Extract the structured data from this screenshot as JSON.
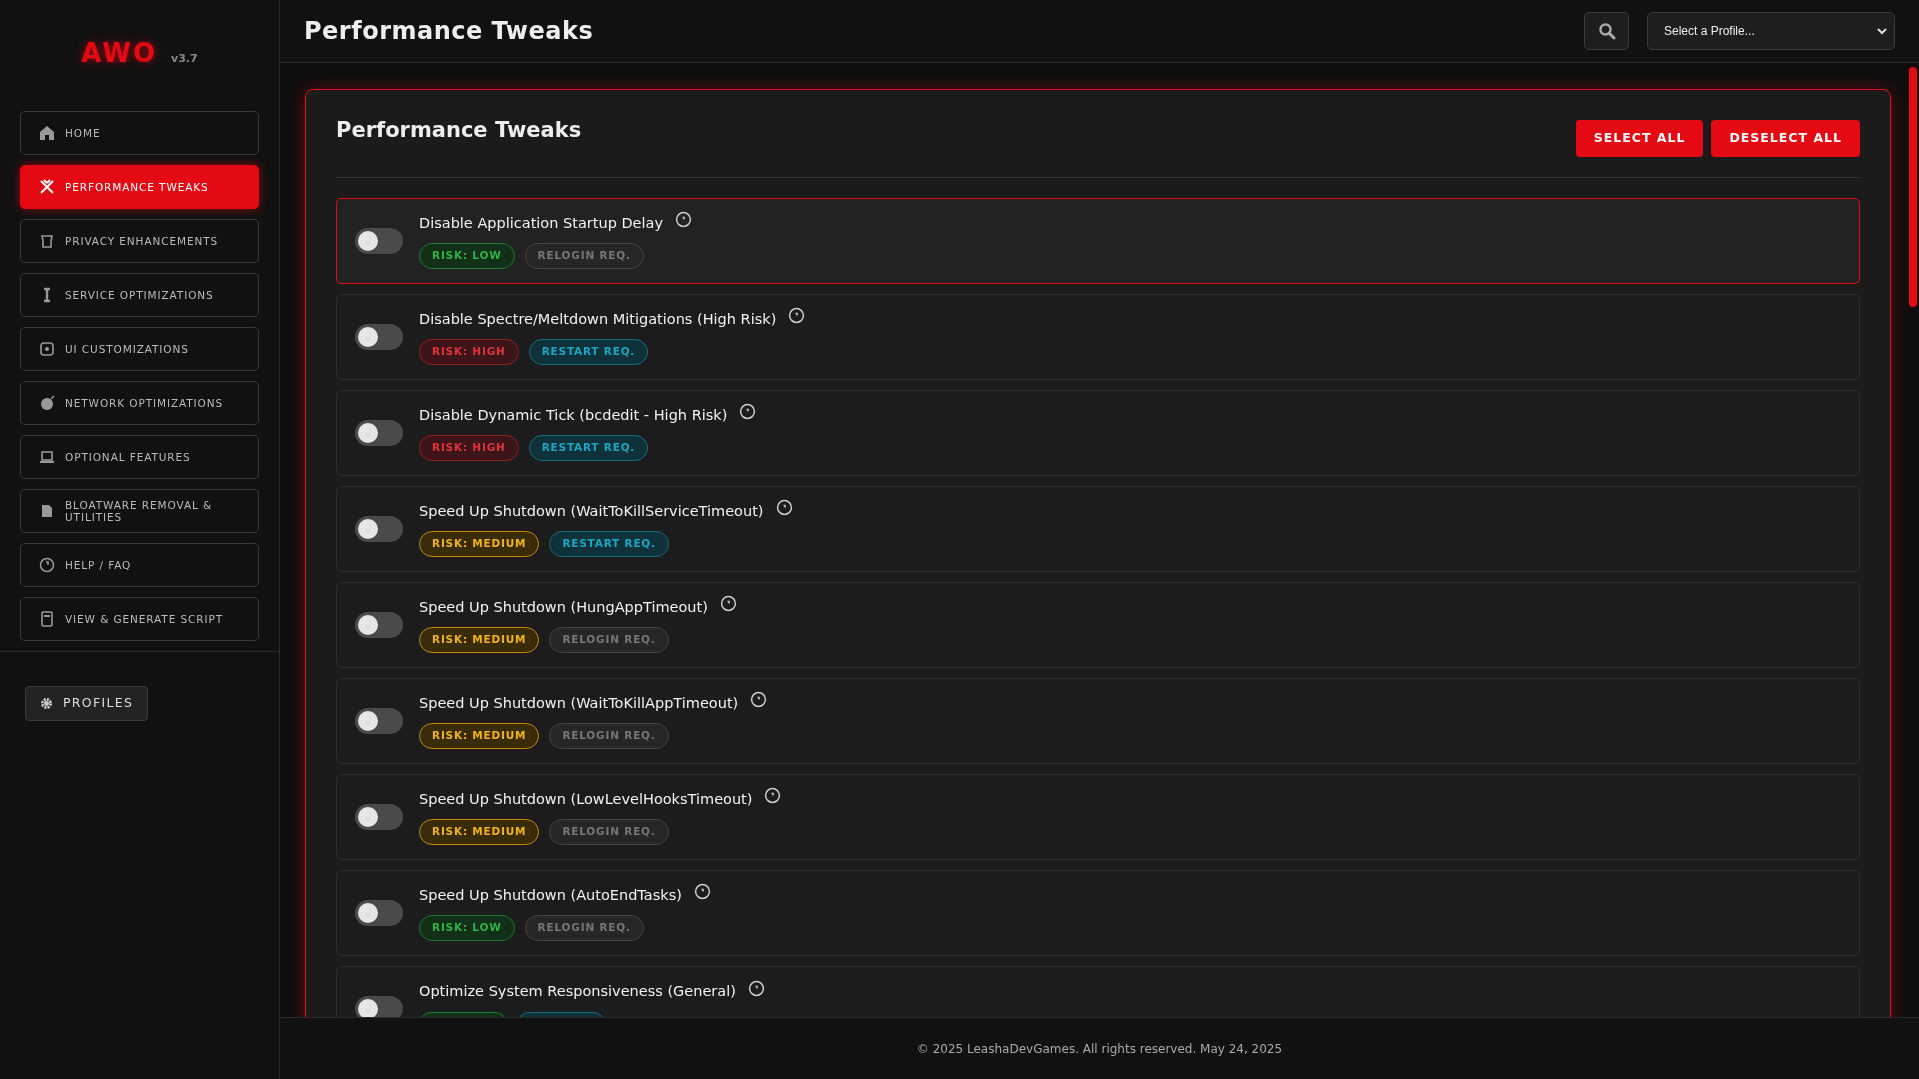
{
  "sidebar": {
    "logo": "AWO",
    "version": "v3.7",
    "items": [
      {
        "label": "HOME",
        "selected": false
      },
      {
        "label": "PERFORMANCE TWEAKS",
        "selected": true
      },
      {
        "label": "PRIVACY ENHANCEMENTS",
        "selected": false
      },
      {
        "label": "SERVICE OPTIMIZATIONS",
        "selected": false
      },
      {
        "label": "UI CUSTOMIZATIONS",
        "selected": false
      },
      {
        "label": "NETWORK OPTIMIZATIONS",
        "selected": false
      },
      {
        "label": "OPTIONAL FEATURES",
        "selected": false
      },
      {
        "label": "BLOATWARE REMOVAL & UTILITIES",
        "selected": false
      },
      {
        "label": "HELP / FAQ",
        "selected": false
      },
      {
        "label": "VIEW & GENERATE SCRIPT",
        "selected": false
      }
    ],
    "profiles_button": "PROFILES"
  },
  "header": {
    "title": "Performance Tweaks",
    "profile_select": "Select a Profile..."
  },
  "panel": {
    "title": "Performance Tweaks",
    "buttons": [
      "SELECT ALL",
      "DESELECT ALL"
    ],
    "tweaks": [
      {
        "name": "Disable Application Startup Delay",
        "on": false,
        "highlighted": true,
        "badges": [
          {
            "kind": "low",
            "label": "RISK: LOW"
          },
          {
            "kind": "relogin",
            "label": "RELOGIN REQ."
          }
        ]
      },
      {
        "name": "Disable Spectre/Meltdown Mitigations (High Risk)",
        "on": false,
        "highlighted": false,
        "badges": [
          {
            "kind": "high",
            "label": "RISK: HIGH"
          },
          {
            "kind": "restart",
            "label": "RESTART REQ."
          }
        ]
      },
      {
        "name": "Disable Dynamic Tick (bcdedit - High Risk)",
        "on": false,
        "highlighted": false,
        "badges": [
          {
            "kind": "high",
            "label": "RISK: HIGH"
          },
          {
            "kind": "restart",
            "label": "RESTART REQ."
          }
        ]
      },
      {
        "name": "Speed Up Shutdown (WaitToKillServiceTimeout)",
        "on": false,
        "highlighted": false,
        "badges": [
          {
            "kind": "medium",
            "label": "RISK: MEDIUM"
          },
          {
            "kind": "restart",
            "label": "RESTART REQ."
          }
        ]
      },
      {
        "name": "Speed Up Shutdown (HungAppTimeout)",
        "on": false,
        "highlighted": false,
        "badges": [
          {
            "kind": "medium",
            "label": "RISK: MEDIUM"
          },
          {
            "kind": "relogin",
            "label": "RELOGIN REQ."
          }
        ]
      },
      {
        "name": "Speed Up Shutdown (WaitToKillAppTimeout)",
        "on": false,
        "highlighted": false,
        "badges": [
          {
            "kind": "medium",
            "label": "RISK: MEDIUM"
          },
          {
            "kind": "relogin",
            "label": "RELOGIN REQ."
          }
        ]
      },
      {
        "name": "Speed Up Shutdown (LowLevelHooksTimeout)",
        "on": false,
        "highlighted": false,
        "badges": [
          {
            "kind": "medium",
            "label": "RISK: MEDIUM"
          },
          {
            "kind": "relogin",
            "label": "RELOGIN REQ."
          }
        ]
      },
      {
        "name": "Speed Up Shutdown (AutoEndTasks)",
        "on": false,
        "highlighted": false,
        "badges": [
          {
            "kind": "low",
            "label": "RISK: LOW"
          },
          {
            "kind": "relogin",
            "label": "RELOGIN REQ."
          }
        ]
      },
      {
        "name": "Optimize System Responsiveness (General)",
        "on": false,
        "highlighted": false,
        "badges": [
          {
            "kind": "low"
          },
          {
            "kind": "restart"
          }
        ]
      }
    ]
  },
  "footer": "© 2025 LeashaDevGames. All rights reserved. May 24, 2025"
}
